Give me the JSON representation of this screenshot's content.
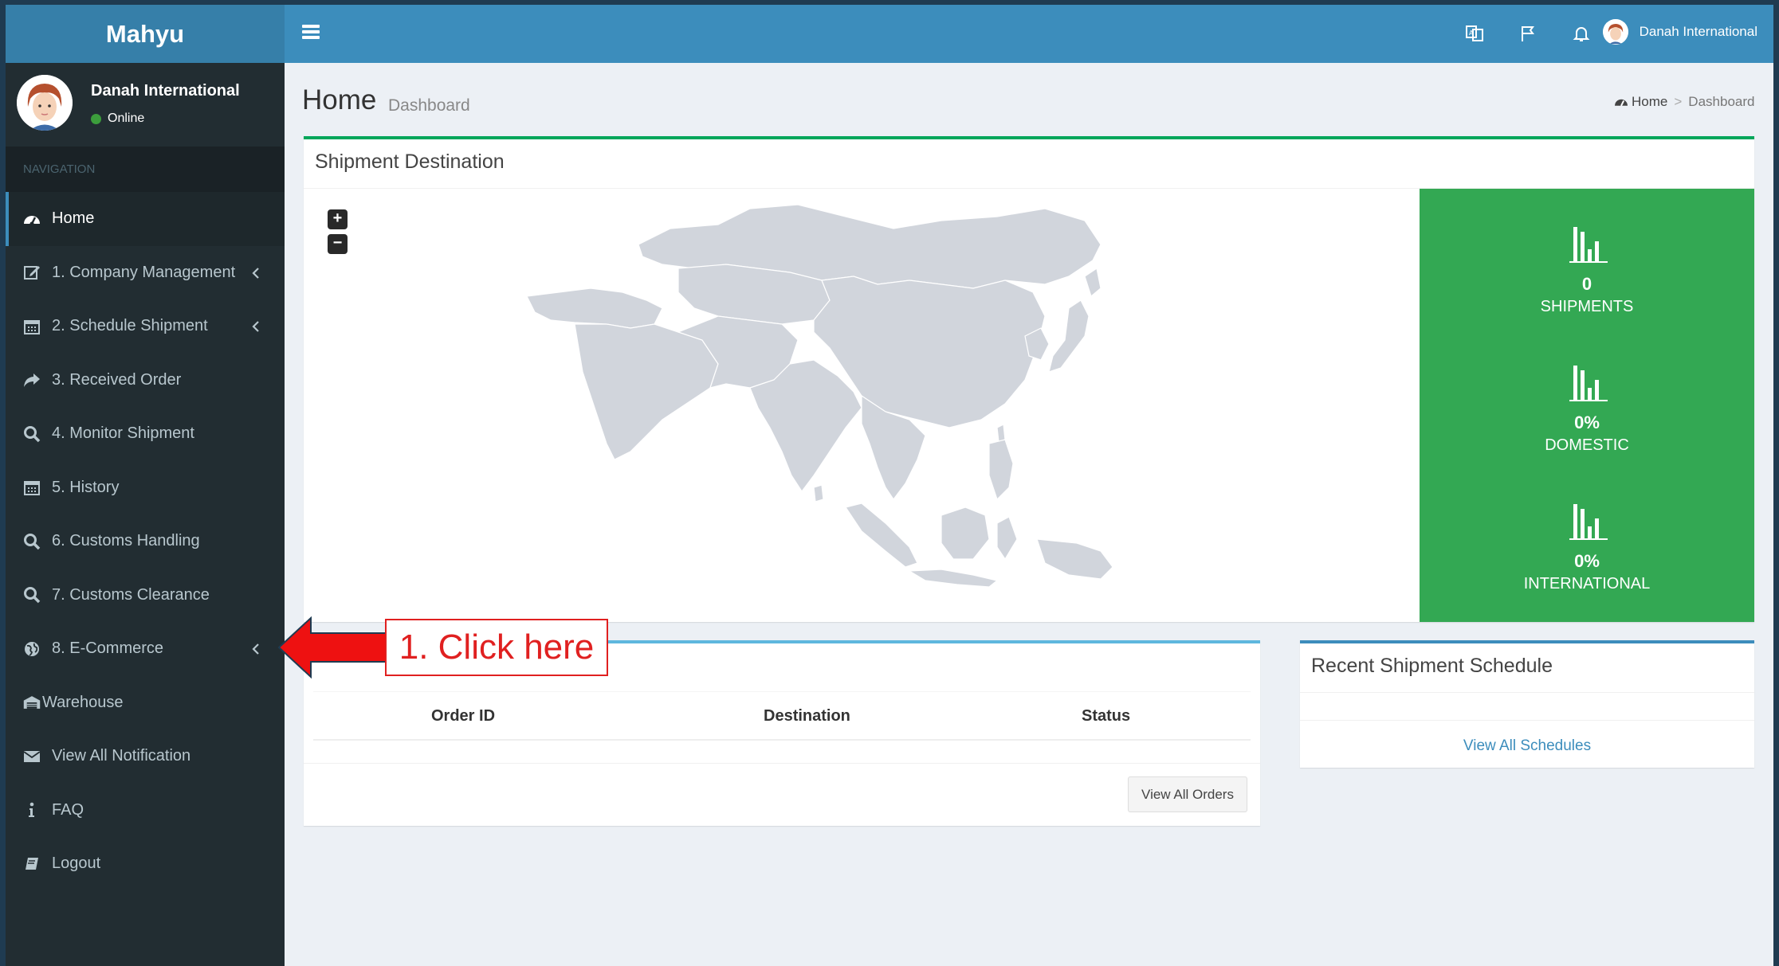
{
  "brand": {
    "name": "Mahyu"
  },
  "user": {
    "name": "Danah International",
    "status": "Online"
  },
  "topbar": {
    "user_name": "Danah International"
  },
  "sidebar": {
    "header": "NAVIGATION",
    "items": [
      {
        "label": "Home",
        "icon": "dashboard-icon",
        "active": true
      },
      {
        "label": "1. Company Management",
        "icon": "edit-icon",
        "has_submenu": true
      },
      {
        "label": "2. Schedule Shipment",
        "icon": "calendar-icon",
        "has_submenu": true
      },
      {
        "label": "3. Received Order",
        "icon": "share-icon"
      },
      {
        "label": "4. Monitor Shipment",
        "icon": "search-icon"
      },
      {
        "label": "5. History",
        "icon": "calendar-icon"
      },
      {
        "label": "6. Customs Handling",
        "icon": "search-icon"
      },
      {
        "label": "7. Customs Clearance",
        "icon": "search-icon"
      },
      {
        "label": "8. E-Commerce",
        "icon": "globe-icon",
        "has_submenu": true
      },
      {
        "label": "Warehouse",
        "icon": "warehouse-icon"
      },
      {
        "label": "View All Notification",
        "icon": "envelope-icon"
      },
      {
        "label": "FAQ",
        "icon": "info-icon"
      },
      {
        "label": "Logout",
        "icon": "book-icon"
      }
    ]
  },
  "page": {
    "title": "Home",
    "subtitle": "Dashboard"
  },
  "breadcrumb": {
    "home": "Home",
    "current": "Dashboard",
    "separator": ">"
  },
  "map_box": {
    "title": "Shipment Destination",
    "zoom_in": "+",
    "zoom_out": "−",
    "stats": [
      {
        "value": "0",
        "label": "SHIPMENTS"
      },
      {
        "value": "0%",
        "label": "DOMESTIC"
      },
      {
        "value": "0%",
        "label": "INTERNATIONAL"
      }
    ]
  },
  "orders_box": {
    "columns": [
      "Order ID",
      "Destination",
      "Status"
    ],
    "button": "View All Orders"
  },
  "recent_box": {
    "title": "Recent Shipment Schedule",
    "link": "View All Schedules"
  },
  "annotation": {
    "text": "1. Click here"
  },
  "colors": {
    "header": "#3c8dbc",
    "logo": "#367fa9",
    "sidebar": "#222d32",
    "stats_green": "#33a853",
    "callout_red": "#e02020"
  }
}
